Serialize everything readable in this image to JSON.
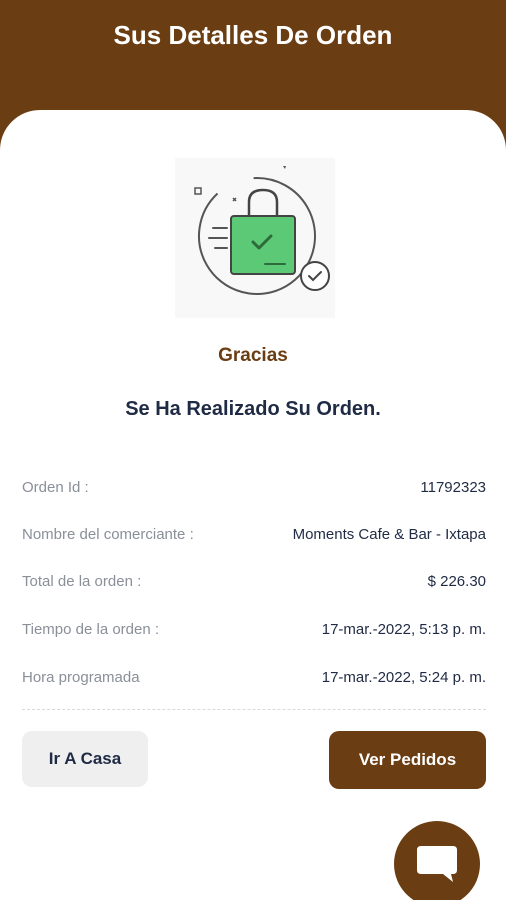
{
  "header": {
    "title": "Sus Detalles De Orden"
  },
  "confirmation": {
    "illustration_icon": "shopping-bag-check-icon",
    "thanks": "Gracias",
    "message": "Se Ha Realizado Su Orden."
  },
  "details": [
    {
      "label": "Orden Id :",
      "value": "11792323"
    },
    {
      "label": "Nombre del comerciante :",
      "value": "Moments Cafe & Bar - Ixtapa"
    },
    {
      "label": "Total de la orden :",
      "value": "$ 226.30"
    },
    {
      "label": "Tiempo de la orden :",
      "value": "17-mar.-2022, 5:13 p. m."
    },
    {
      "label": "Hora programada",
      "value": "17-mar.-2022, 5:24 p. m."
    }
  ],
  "actions": {
    "home_label": "Ir A Casa",
    "orders_label": "Ver Pedidos"
  },
  "chat": {
    "icon": "chat-bubble-icon"
  },
  "colors": {
    "brand": "#6b3d12",
    "bag_green": "#5cc977",
    "text_dark": "#1f2a44",
    "text_muted": "#8a8f98"
  }
}
